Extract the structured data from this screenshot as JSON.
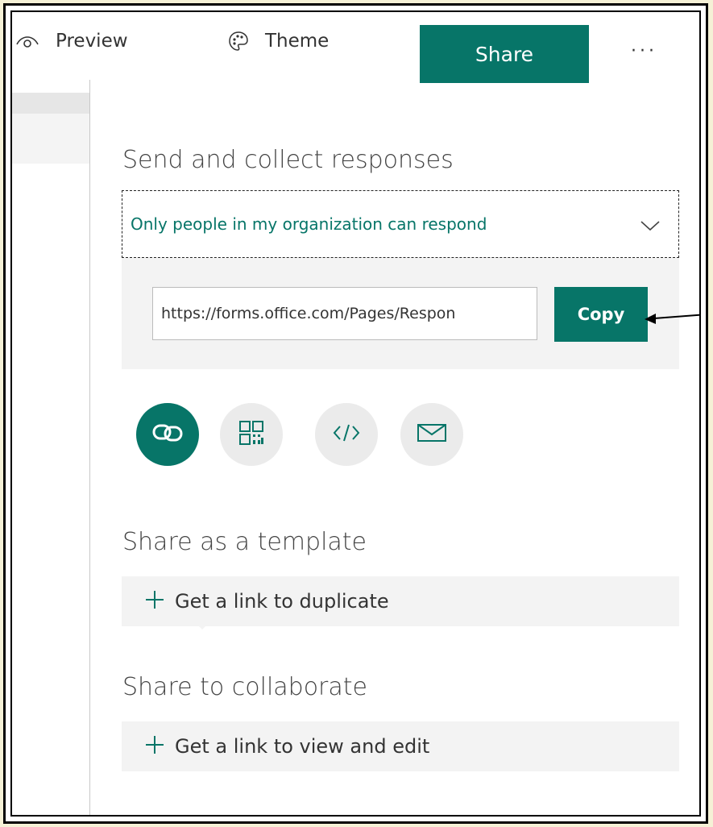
{
  "toolbar": {
    "preview_label": "Preview",
    "theme_label": "Theme",
    "share_label": "Share",
    "more_label": "···",
    "icons": {
      "preview": "eye-icon",
      "theme": "palette-icon"
    }
  },
  "send": {
    "title": "Send and collect responses",
    "audience_selected": "Only people in my organization can respond",
    "link_value": "https://forms.office.com/Pages/Respon",
    "copy_label": "Copy",
    "share_methods": [
      {
        "name": "link-icon",
        "active": true
      },
      {
        "name": "qr-code-icon",
        "active": false
      },
      {
        "name": "embed-code-icon",
        "active": false
      },
      {
        "name": "email-icon",
        "active": false
      }
    ]
  },
  "template": {
    "title": "Share as a template",
    "action_label": "Get a link to duplicate"
  },
  "collaborate": {
    "title": "Share to collaborate",
    "action_label": "Get a link to view and edit"
  },
  "colors": {
    "accent": "#077568",
    "panel": "#f3f3f3"
  }
}
